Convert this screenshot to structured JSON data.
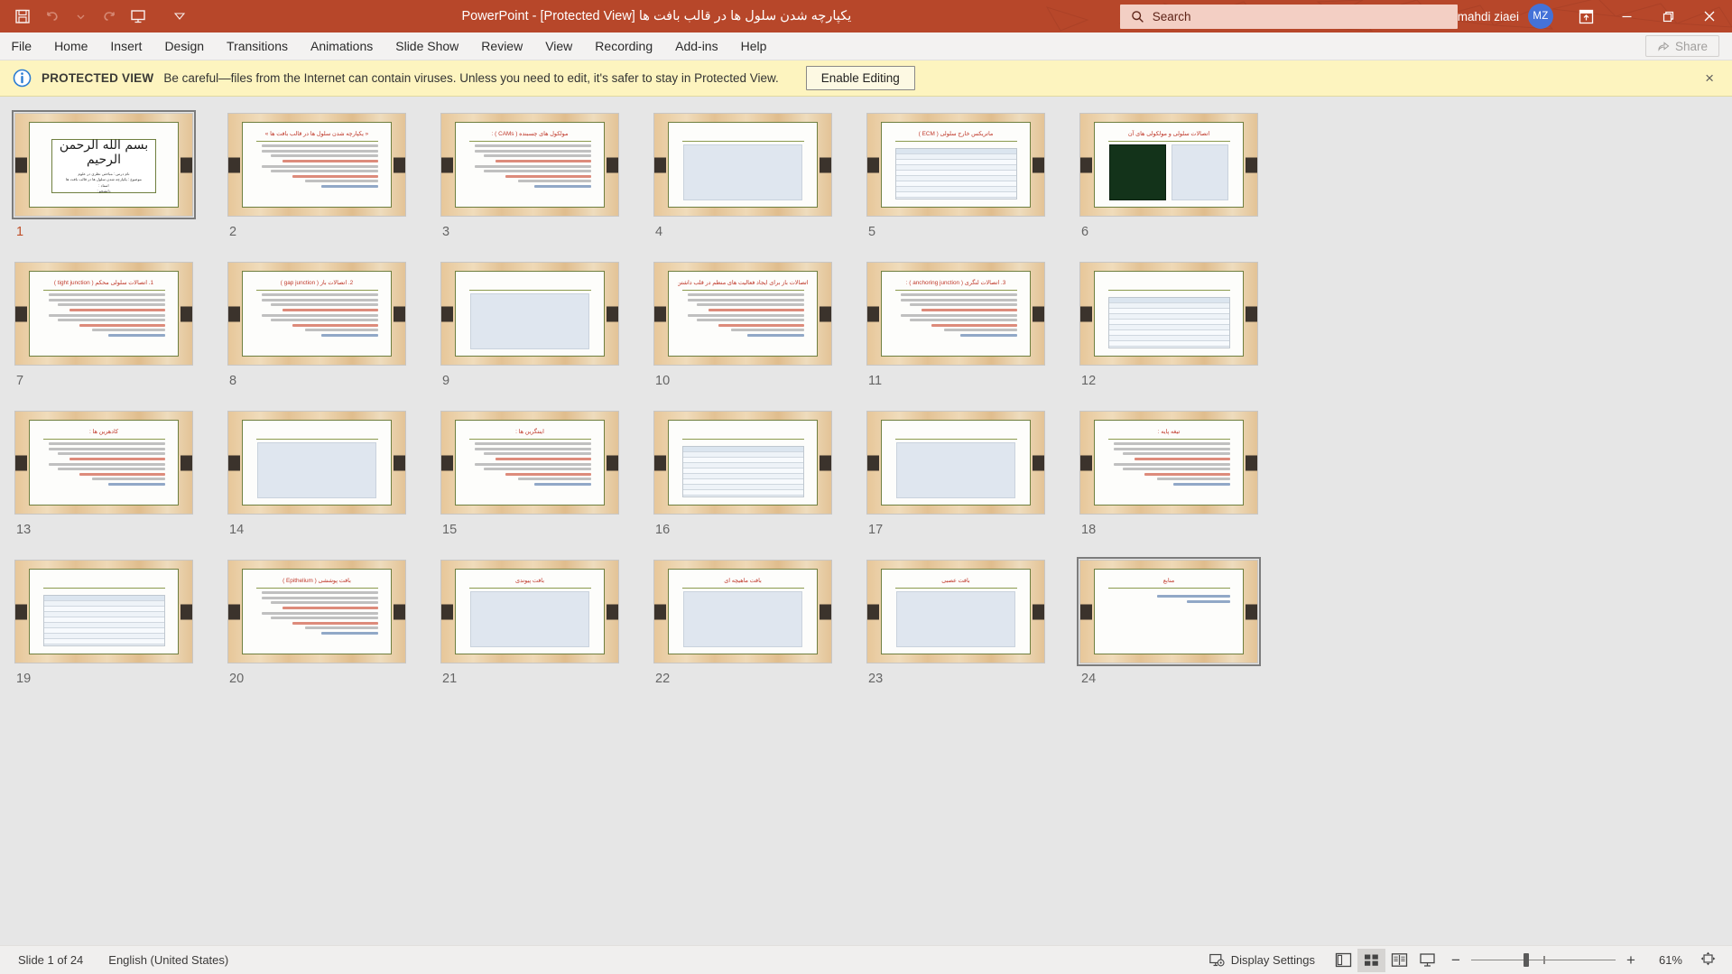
{
  "titlebar": {
    "document_title": "یکپارچه شدن سلول ها در قالب بافت ها  [Protected View]  -  PowerPoint",
    "qat": [
      {
        "name": "save-icon",
        "label": "Save"
      },
      {
        "name": "undo-icon",
        "label": "Undo"
      },
      {
        "name": "undo-dropdown-icon",
        "label": "Undo options"
      },
      {
        "name": "redo-icon",
        "label": "Redo"
      },
      {
        "name": "start-slideshow-icon",
        "label": "Start From Beginning"
      },
      {
        "name": "customize-qat-icon",
        "label": "Customize Quick Access Toolbar"
      }
    ],
    "search_placeholder": "Search",
    "account_name": "mahdi ziaei",
    "account_initials": "MZ",
    "window_buttons": [
      "ribbon-display-options",
      "minimize",
      "restore",
      "close"
    ],
    "accent_color": "#b7472a",
    "search_bg": "#f3cfc4",
    "avatar_color": "#4472d8"
  },
  "ribbon": {
    "tabs": [
      "File",
      "Home",
      "Insert",
      "Design",
      "Transitions",
      "Animations",
      "Slide Show",
      "Review",
      "View",
      "Recording",
      "Add-ins",
      "Help"
    ],
    "share_label": "Share"
  },
  "protected_view": {
    "badge": "PROTECTED VIEW",
    "message": "Be careful—files from the Internet can contain viruses. Unless you need to edit, it's safer to stay in Protected View.",
    "enable_label": "Enable Editing",
    "close_label": "×",
    "bg_color": "#fdf4bf"
  },
  "slides": [
    {
      "n": "1",
      "kind": "title",
      "title": "بسم الله الرحمن الرحیم",
      "sub": "نام درس : مباحثی نظری در علوم\nموضوع : یکپارچه شدن سلول ها در قالب بافت ها\nاستاد :\nدانشجو :",
      "selected": true
    },
    {
      "n": "2",
      "kind": "text",
      "title": "« یکپارچه شدن سلول ها در قالب بافت ها »"
    },
    {
      "n": "3",
      "kind": "text",
      "title": "مولکول های چسبنده ( CAMs ) :"
    },
    {
      "n": "4",
      "kind": "figure",
      "title": ""
    },
    {
      "n": "5",
      "kind": "table",
      "title": "ماتریکس خارج سلولی ( ECM )"
    },
    {
      "n": "6",
      "kind": "figure-green",
      "title": "اتصالات سلولی و مولکولی های آن"
    },
    {
      "n": "7",
      "kind": "text",
      "title": "1. اتصالات سلولی محکم ( tight junction )"
    },
    {
      "n": "8",
      "kind": "text",
      "title": "2. اتصالات باز ( gap junction )"
    },
    {
      "n": "9",
      "kind": "figure",
      "title": ""
    },
    {
      "n": "10",
      "kind": "text",
      "title": "اتصالات باز برای ایجاد فعالیت های منظم در قلب داشتن به وجود آمده"
    },
    {
      "n": "11",
      "kind": "text",
      "title": "3. اتصالات لنگری ( anchoring junction ) :"
    },
    {
      "n": "12",
      "kind": "table-pink",
      "title": ""
    },
    {
      "n": "13",
      "kind": "text",
      "title": "کادهرین ها  :"
    },
    {
      "n": "14",
      "kind": "figure",
      "title": ""
    },
    {
      "n": "15",
      "kind": "text",
      "title": "اینتگرین ها :"
    },
    {
      "n": "16",
      "kind": "table-pink",
      "title": ""
    },
    {
      "n": "17",
      "kind": "figure",
      "title": ""
    },
    {
      "n": "18",
      "kind": "text",
      "title": "تیغه پایه :"
    },
    {
      "n": "19",
      "kind": "table-pink",
      "title": ""
    },
    {
      "n": "20",
      "kind": "text",
      "title": "بافت پوششی ( Epithelium )"
    },
    {
      "n": "21",
      "kind": "figure",
      "title": "بافت پیوندی"
    },
    {
      "n": "22",
      "kind": "figure",
      "title": "بافت ماهیچه ای"
    },
    {
      "n": "23",
      "kind": "figure",
      "title": "بافت عصبی"
    },
    {
      "n": "24",
      "kind": "refs",
      "title": "منابع",
      "selected": true
    }
  ],
  "statusbar": {
    "slide_indicator": "Slide 1 of 24",
    "language": "English (United States)",
    "display_settings": "Display Settings",
    "views": [
      {
        "name": "normal-view-button",
        "label": "Normal",
        "active": false
      },
      {
        "name": "slide-sorter-view-button",
        "label": "Slide Sorter",
        "active": true
      },
      {
        "name": "reading-view-button",
        "label": "Reading View",
        "active": false
      },
      {
        "name": "slide-show-button",
        "label": "Slide Show",
        "active": false
      }
    ],
    "zoom_out_label": "−",
    "zoom_in_label": "+",
    "zoom_level": "61%",
    "fit_label": "Fit slide to current window"
  }
}
